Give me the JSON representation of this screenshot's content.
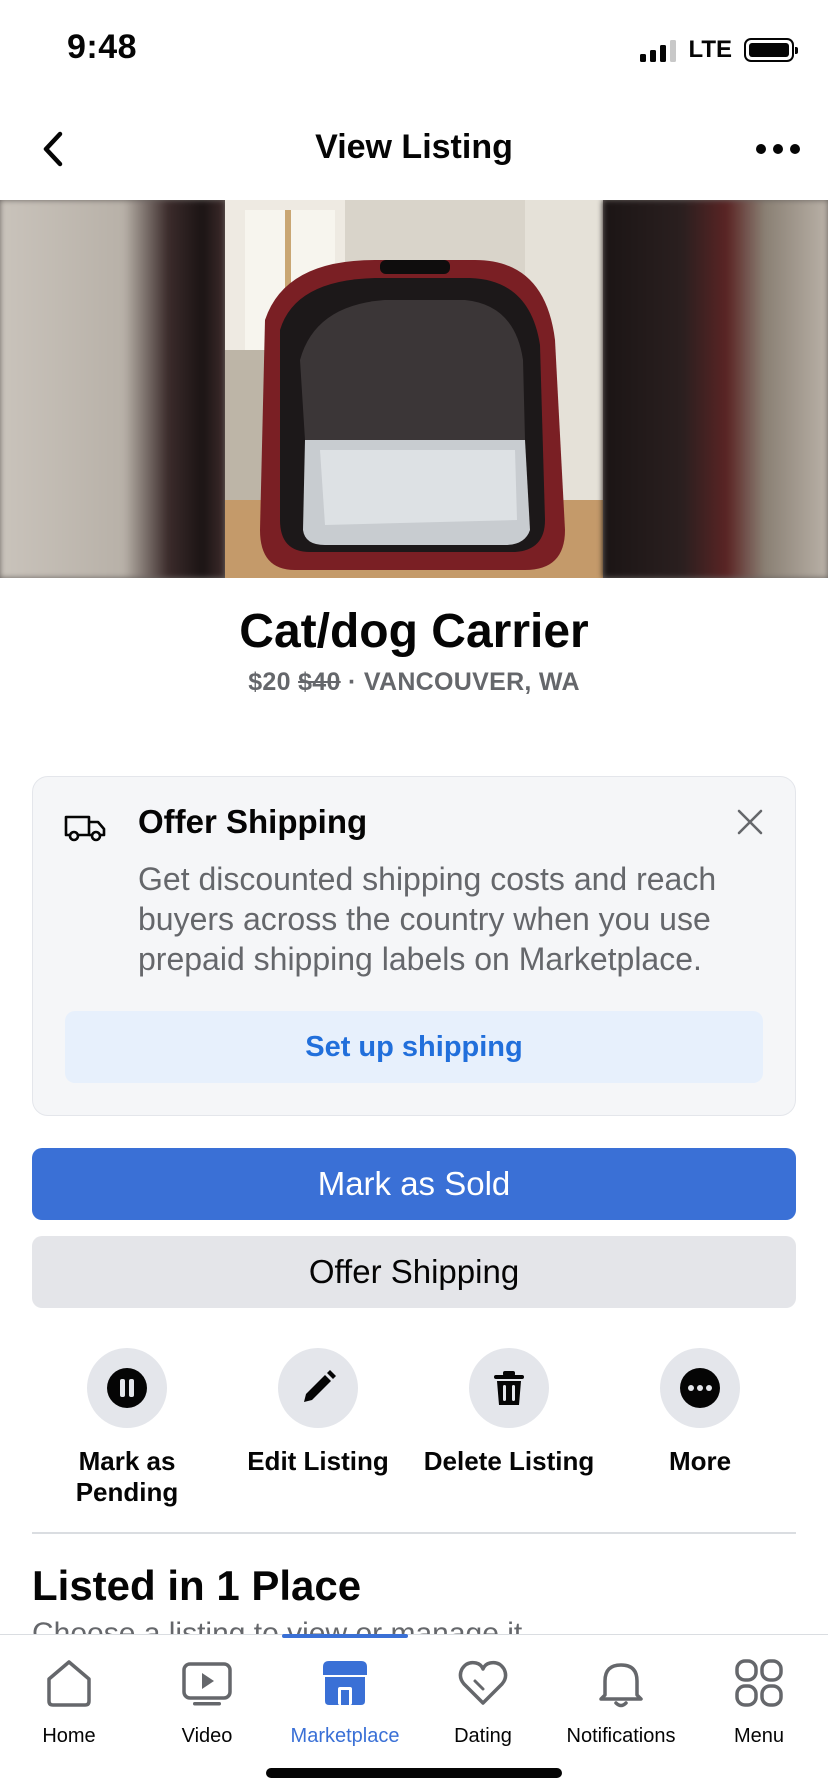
{
  "status_bar": {
    "time": "9:48",
    "network": "LTE"
  },
  "header": {
    "title": "View Listing"
  },
  "listing": {
    "title": "Cat/dog Carrier",
    "price": "$20",
    "original_price": "$40",
    "separator": "·",
    "location": "VANCOUVER, WA"
  },
  "shipping_card": {
    "title": "Offer Shipping",
    "description": "Get discounted shipping costs and reach buyers across the country when you use prepaid shipping labels on Marketplace.",
    "button_label": "Set up shipping"
  },
  "buttons": {
    "mark_sold": "Mark as Sold",
    "offer_shipping": "Offer Shipping"
  },
  "actions": [
    {
      "label": "Mark as Pending",
      "icon": "pause-icon"
    },
    {
      "label": "Edit Listing",
      "icon": "pencil-icon"
    },
    {
      "label": "Delete Listing",
      "icon": "trash-icon"
    },
    {
      "label": "More",
      "icon": "more-icon"
    }
  ],
  "places_section": {
    "title": "Listed in 1 Place",
    "subtitle": "Choose a listing to view or manage it."
  },
  "tab_bar": {
    "active": "Marketplace",
    "tabs": [
      {
        "label": "Home",
        "icon": "home-icon"
      },
      {
        "label": "Video",
        "icon": "video-icon"
      },
      {
        "label": "Marketplace",
        "icon": "marketplace-icon"
      },
      {
        "label": "Dating",
        "icon": "heart-icon"
      },
      {
        "label": "Notifications",
        "icon": "bell-icon"
      },
      {
        "label": "Menu",
        "icon": "menu-grid-icon"
      }
    ]
  },
  "colors": {
    "accent": "#3a70d6",
    "secondary_text": "#65676b",
    "card_bg": "#f5f6f8",
    "setup_button_bg": "#e7f0fc"
  }
}
